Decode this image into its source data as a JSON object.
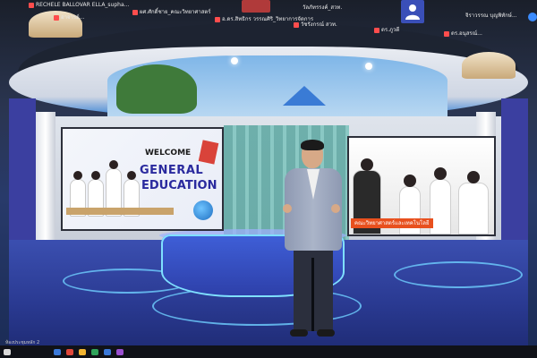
{
  "participants": [
    {
      "name": "RECHELE BALLOVAR ELLA_supha...",
      "muted": true
    },
    {
      "name": "ผศ.ศักดิ์ชาย_คณะวิทยาศาสตร์",
      "muted": true
    },
    {
      "name": "อ.ดร.สิทธิกร วรรณศิริ_วิทยาการจัดการ",
      "muted": true
    },
    {
      "name": "วัชรังกรณ์ สวท.",
      "muted": true
    },
    {
      "name": "วัลภัทรรงค์_สวท.",
      "muted": false
    },
    {
      "name": "ดร.ภูวดี",
      "muted": true
    },
    {
      "name": "จิราวรรณ บุญพิทักษ์...",
      "muted": false
    },
    {
      "name": "ดร.อนุสรณ์...",
      "muted": true
    },
    {
      "name": "อาจารย์...",
      "muted": true
    }
  ],
  "screen_left": {
    "welcome": "WELCOME",
    "title_line1": "GENERAL",
    "title_line2": "EDUCATION"
  },
  "screen_right": {
    "caption": "คณะวิทยาศาสตร์และเทคโนโลยี"
  },
  "status": {
    "label": "ห้องประชุมหลัก 2"
  },
  "colors": {
    "accent": "#2e7cd4",
    "floor": "#2a3a92",
    "caption_bg": "#e8501e"
  }
}
